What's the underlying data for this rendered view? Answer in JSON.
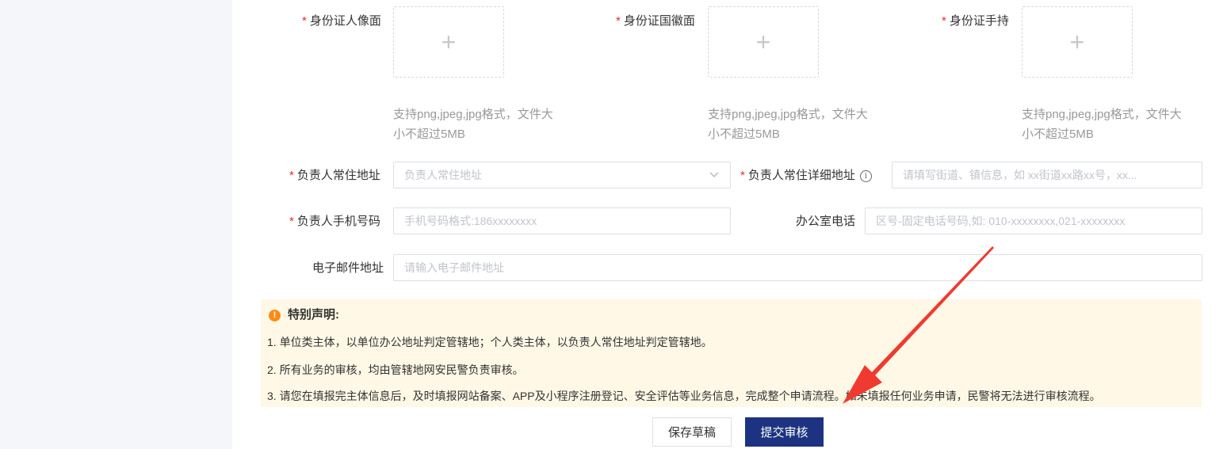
{
  "uploads": {
    "front": {
      "label": "身份证人像面",
      "required": true,
      "hint": "支持png,jpeg,jpg格式，文件大小不超过5MB"
    },
    "back": {
      "label": "身份证国徽面",
      "required": true,
      "hint": "支持png,jpeg,jpg格式，文件大小不超过5MB"
    },
    "hold": {
      "label": "身份证手持",
      "required": true,
      "hint": "支持png,jpeg,jpg格式，文件大小不超过5MB"
    },
    "plus_symbol": "+",
    "hint_line1": "支持png,jpeg,jpg格式，文件大",
    "hint_line2": "小不超过5MB"
  },
  "form": {
    "residence": {
      "label": "负责人常住地址",
      "placeholder": "负责人常住地址",
      "required": true
    },
    "residence_detail": {
      "label": "负责人常住详细地址",
      "placeholder": "请填写街道、镇信息，如 xx街道xx路xx号，xx...",
      "required": true
    },
    "mobile": {
      "label": "负责人手机号码",
      "placeholder": "手机号码格式:186xxxxxxxx",
      "required": true
    },
    "office_phone": {
      "label": "办公室电话",
      "placeholder": "区号-固定电话号码,如: 010-xxxxxxxx,021-xxxxxxxx",
      "required": false
    },
    "email": {
      "label": "电子邮件地址",
      "placeholder": "请输入电子邮件地址",
      "required": false
    },
    "required_mark": "*"
  },
  "notice": {
    "title": "特别声明:",
    "icon": "!",
    "lines": [
      "1. 单位类主体，以单位办公地址判定管辖地；个人类主体，以负责人常住地址判定管辖地。",
      "2. 所有业务的审核，均由管辖地网安民警负责审核。",
      "3. 请您在填报完主体信息后，及时填报网站备案、APP及小程序注册登记、安全评估等业务信息，完成整个申请流程。如未填报任何业务申请，民警将无法进行审核流程。"
    ]
  },
  "actions": {
    "save_draft": "保存草稿",
    "submit": "提交审核"
  },
  "colors": {
    "primary": "#1d3381",
    "required": "#f5222d",
    "notice_bg": "#fff8e6",
    "warn_icon": "#fa8c16",
    "arrow": "#f03a2f"
  }
}
